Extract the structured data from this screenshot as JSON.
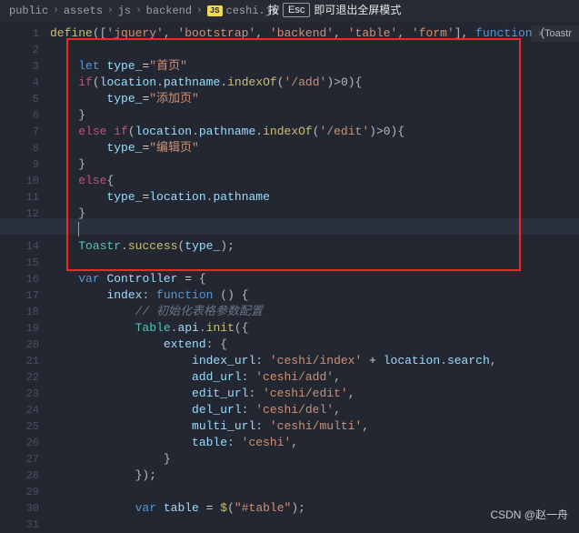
{
  "breadcrumb": {
    "p1": "public",
    "p2": "assets",
    "p3": "js",
    "p4": "backend",
    "p5_badge": "JS",
    "p5": "ceshi.js"
  },
  "hint": {
    "k1": "按",
    "k2": "Esc",
    "k3": "即可退出全屏模式"
  },
  "right_tab": "Toastr",
  "watermark": "CSDN @赵一舟",
  "lines": {
    "start": 1,
    "end": 31,
    "active": 13
  },
  "code": {
    "l1_define": "define",
    "l1_a": "'jquery'",
    "l1_b": "'bootstrap'",
    "l1_c": "'backend'",
    "l1_d": "'table'",
    "l1_e": "'form'",
    "l1_func": "function",
    "l3_let": "let",
    "l3_var": "type_",
    "l3_val": "\"首页\"",
    "l4_loc": "location",
    "l4_pname": "pathname",
    "l4_indexOf": "indexOf",
    "l4_arg": "'/add'",
    "l5_val": "\"添加页\"",
    "l7_arg": "'/edit'",
    "l8_val": "\"编辑页\"",
    "l11_loc": "location",
    "l11_pname": "pathname",
    "l14_toastr": "Toastr",
    "l14_success": "success",
    "l16_var": "var",
    "l16_ctrl": "Controller",
    "l17_index": "index",
    "l17_func": "function",
    "l18_comment": "// 初始化表格参数配置",
    "l19_table": "Table",
    "l19_api": "api",
    "l19_init": "init",
    "l20_extend": "extend",
    "l21_k": "index_url",
    "l21_v": "'ceshi/index'",
    "l21_loc": "location",
    "l21_search": "search",
    "l22_k": "add_url",
    "l22_v": "'ceshi/add'",
    "l23_k": "edit_url",
    "l23_v": "'ceshi/edit'",
    "l24_k": "del_url",
    "l24_v": "'ceshi/del'",
    "l25_k": "multi_url",
    "l25_v": "'ceshi/multi'",
    "l26_k": "table",
    "l26_v": "'ceshi'",
    "l30_var": "var",
    "l30_tbl": "table",
    "l30_jq": "$",
    "l30_sel": "\"#table\""
  }
}
